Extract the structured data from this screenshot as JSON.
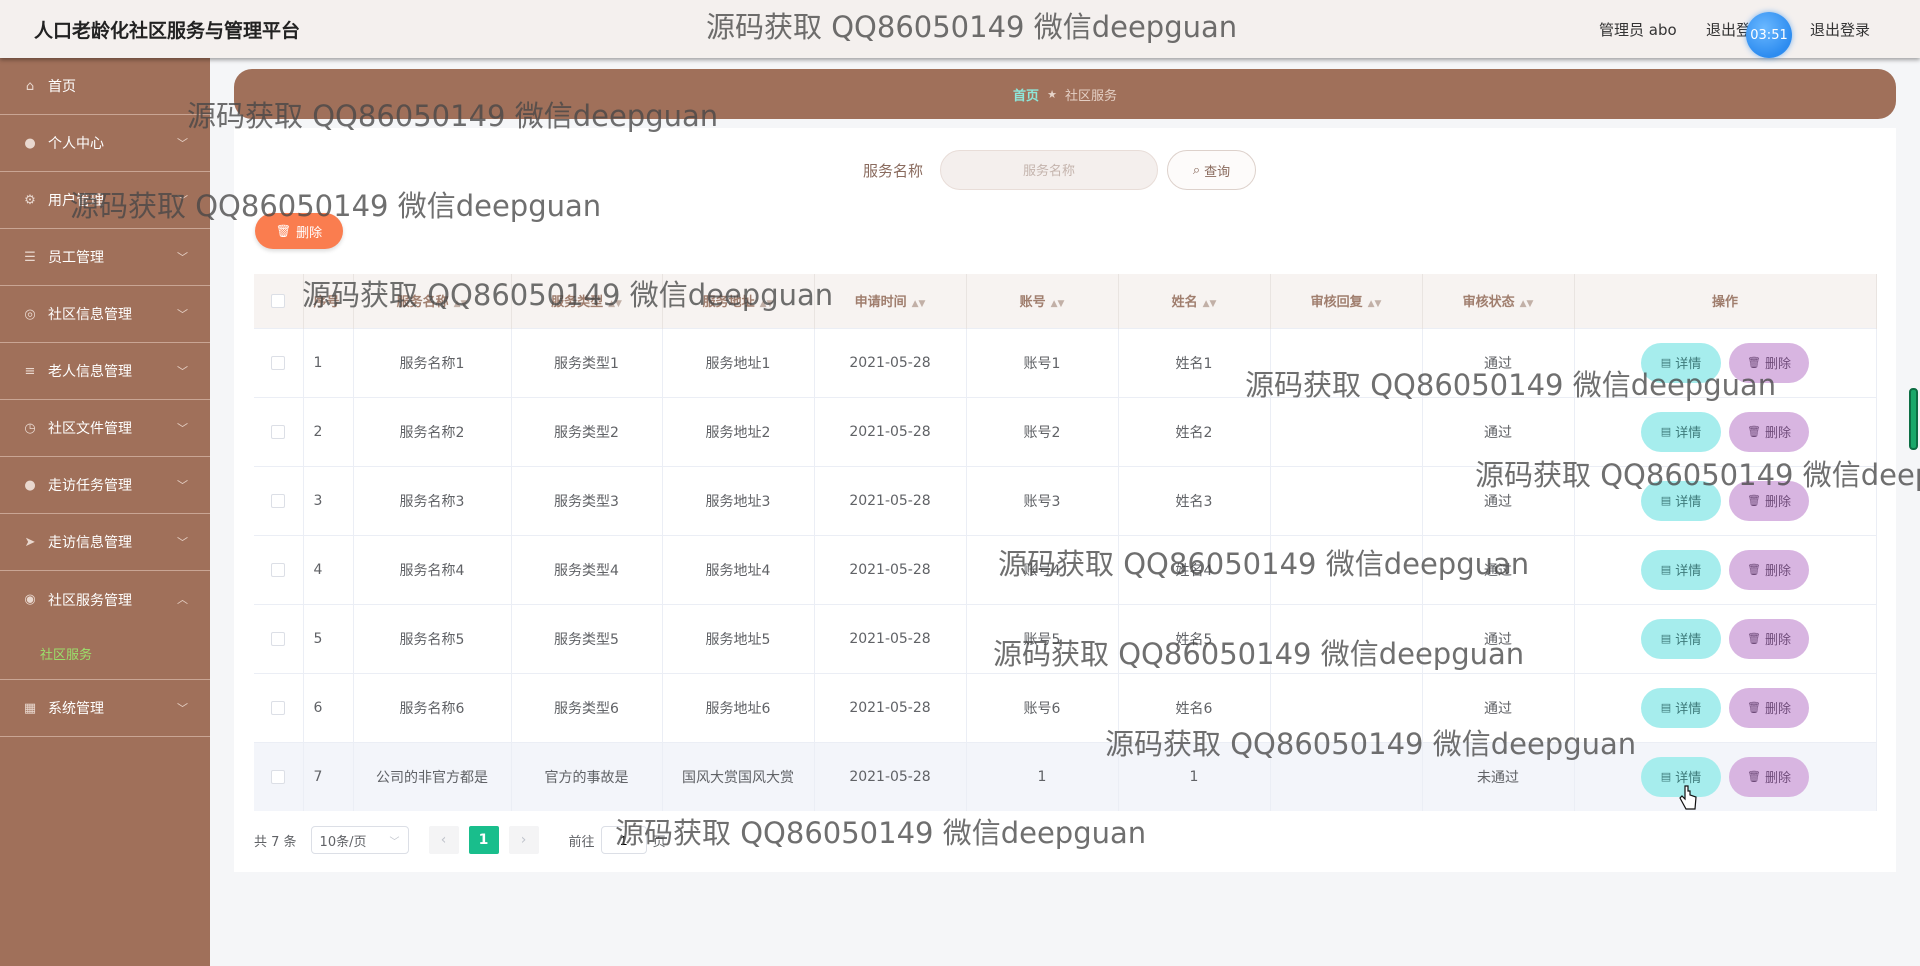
{
  "app": {
    "title": "人口老龄化社区服务与管理平台"
  },
  "header": {
    "user_label": "管理员 abo",
    "logout_partial": "退出登",
    "timer": "03:51",
    "logout_label": "退出登录"
  },
  "sidebar": {
    "items": [
      {
        "label": "首页",
        "icon": "home-icon"
      },
      {
        "label": "个人中心",
        "icon": "user-icon"
      },
      {
        "label": "用户管理",
        "icon": "gear-icon"
      },
      {
        "label": "员工管理",
        "icon": "list-icon"
      },
      {
        "label": "社区信息管理",
        "icon": "info-icon"
      },
      {
        "label": "老人信息管理",
        "icon": "menu-icon"
      },
      {
        "label": "社区文件管理",
        "icon": "clock-icon"
      },
      {
        "label": "走访任务管理",
        "icon": "user-icon"
      },
      {
        "label": "走访信息管理",
        "icon": "send-icon"
      },
      {
        "label": "社区服务管理",
        "icon": "service-icon"
      },
      {
        "label": "社区服务",
        "icon": ""
      },
      {
        "label": "系统管理",
        "icon": "system-icon"
      }
    ]
  },
  "breadcrumb": {
    "home": "首页",
    "current": "社区服务"
  },
  "search": {
    "label": "服务名称",
    "placeholder": "服务名称",
    "button": "查询"
  },
  "toolbar": {
    "delete_label": "删除"
  },
  "table": {
    "headers": [
      "序号",
      "服务名称",
      "服务类型",
      "服务地址",
      "申请时间",
      "账号",
      "姓名",
      "审核回复",
      "审核状态",
      "操作"
    ],
    "rows": [
      {
        "idx": "1",
        "name": "服务名称1",
        "type": "服务类型1",
        "addr": "服务地址1",
        "time": "2021-05-28",
        "account": "账号1",
        "person": "姓名1",
        "reply": "",
        "status": "通过"
      },
      {
        "idx": "2",
        "name": "服务名称2",
        "type": "服务类型2",
        "addr": "服务地址2",
        "time": "2021-05-28",
        "account": "账号2",
        "person": "姓名2",
        "reply": "",
        "status": "通过"
      },
      {
        "idx": "3",
        "name": "服务名称3",
        "type": "服务类型3",
        "addr": "服务地址3",
        "time": "2021-05-28",
        "account": "账号3",
        "person": "姓名3",
        "reply": "",
        "status": "通过"
      },
      {
        "idx": "4",
        "name": "服务名称4",
        "type": "服务类型4",
        "addr": "服务地址4",
        "time": "2021-05-28",
        "account": "账号4",
        "person": "姓名4",
        "reply": "",
        "status": "通过"
      },
      {
        "idx": "5",
        "name": "服务名称5",
        "type": "服务类型5",
        "addr": "服务地址5",
        "time": "2021-05-28",
        "account": "账号5",
        "person": "姓名5",
        "reply": "",
        "status": "通过"
      },
      {
        "idx": "6",
        "name": "服务名称6",
        "type": "服务类型6",
        "addr": "服务地址6",
        "time": "2021-05-28",
        "account": "账号6",
        "person": "姓名6",
        "reply": "",
        "status": "通过"
      },
      {
        "idx": "7",
        "name": "公司的非官方都是",
        "type": "官方的事故是",
        "addr": "国风大赏国风大赏",
        "time": "2021-05-28",
        "account": "1",
        "person": "1",
        "reply": "",
        "status": "未通过"
      }
    ],
    "actions": {
      "detail": "详情",
      "delete": "删除"
    }
  },
  "pagination": {
    "total": "共 7 条",
    "page_size": "10条/页",
    "current": "1",
    "goto_label": "前往",
    "goto_value": "1",
    "goto_unit": "页"
  },
  "watermark": "源码获取 QQ86050149 微信deepguan",
  "colors": {
    "sidebar": "#a0705a",
    "accent_green": "#19be8c",
    "danger": "#fa7d4f",
    "detail": "#a6eded",
    "delete": "#d8b5e1"
  }
}
